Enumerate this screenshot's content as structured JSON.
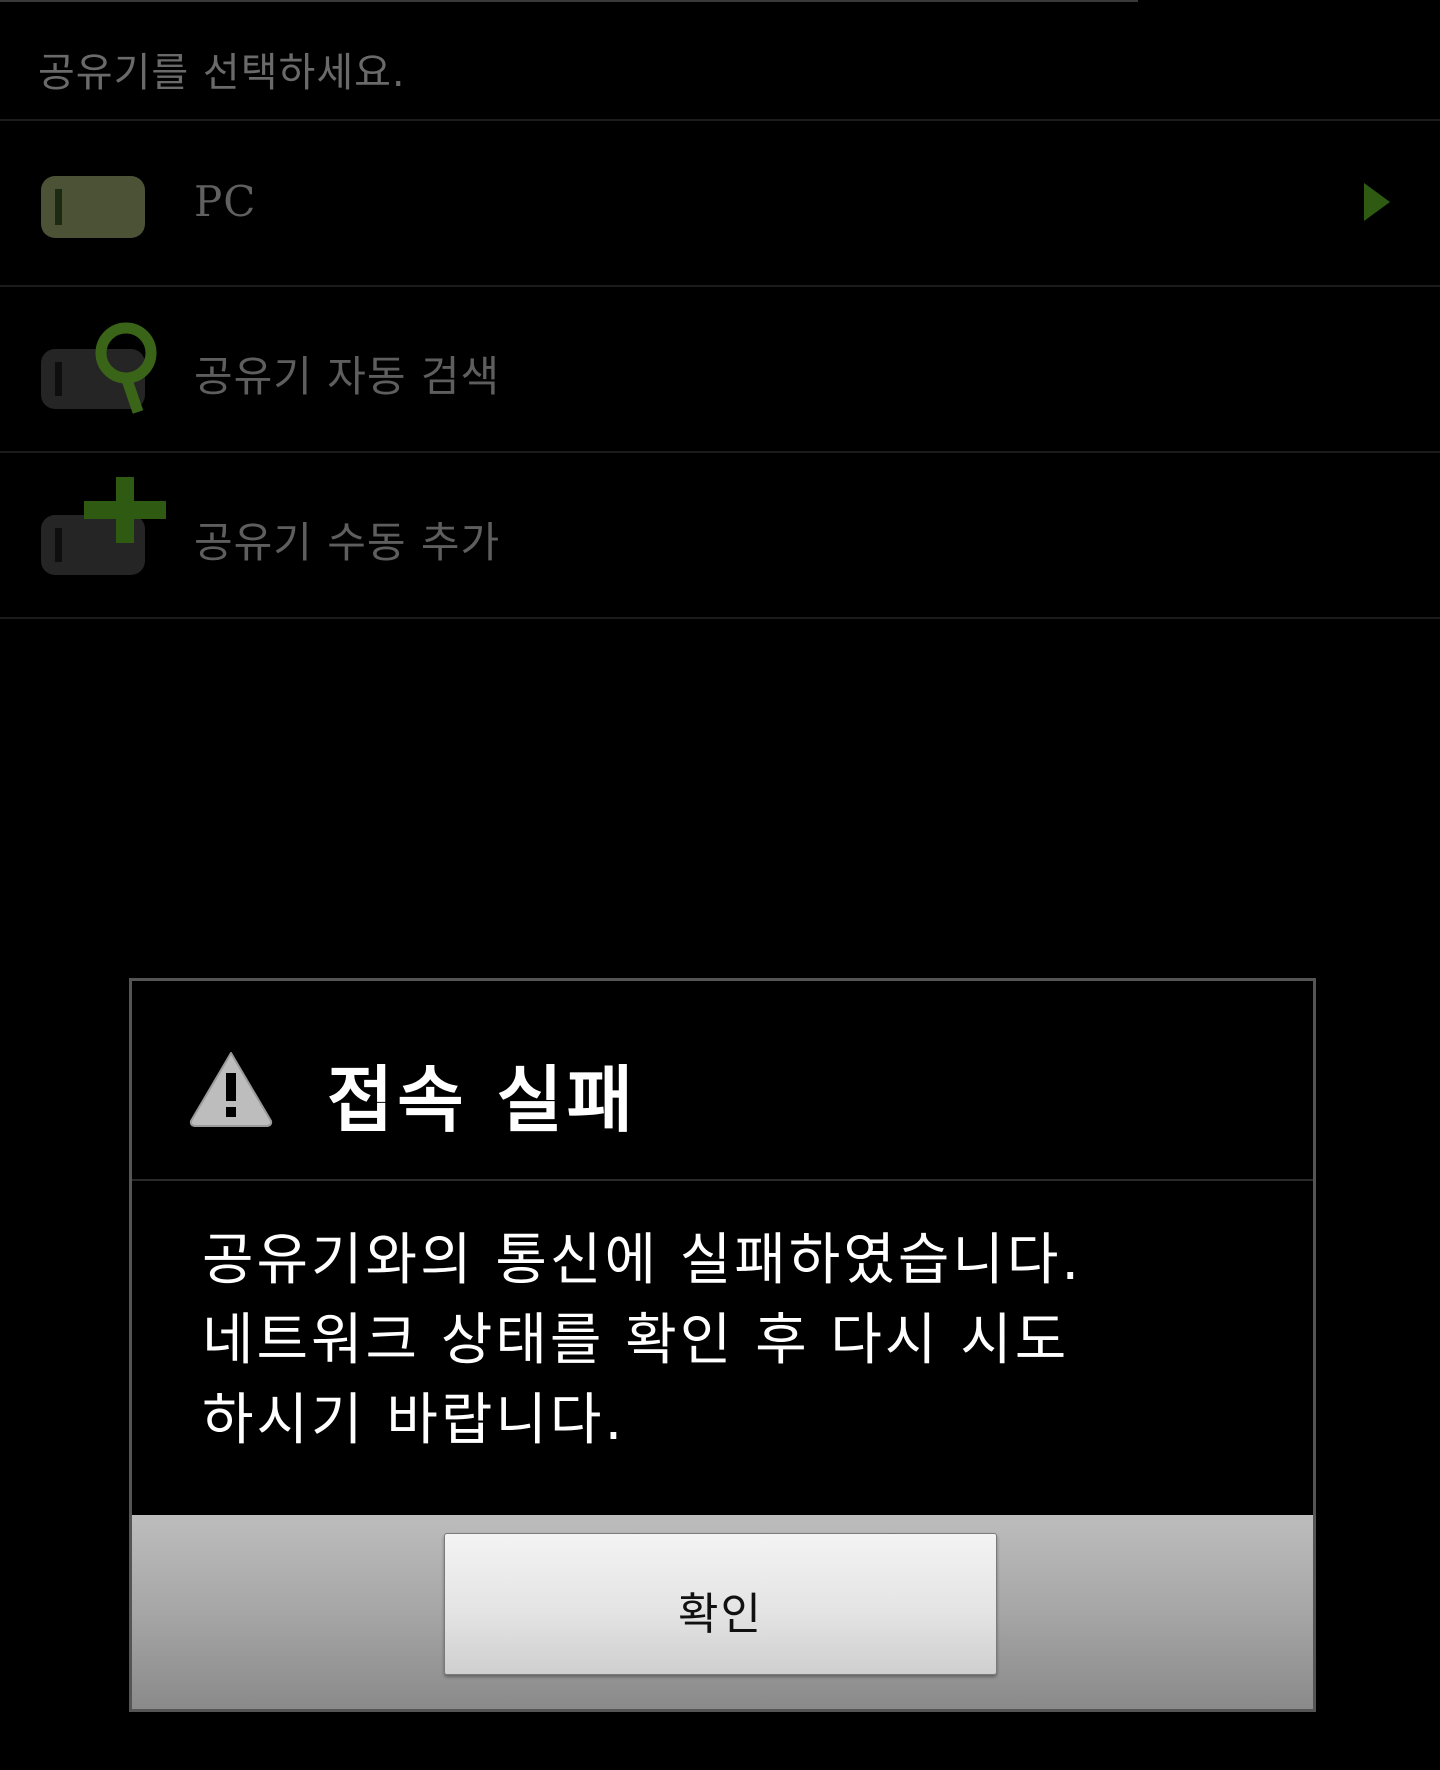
{
  "screen": {
    "header": "공유기를 선택하세요.",
    "items": [
      {
        "label": "PC",
        "icon": "router-icon",
        "has_chevron": true
      },
      {
        "label": "공유기 자동 검색",
        "icon": "router-search-icon"
      },
      {
        "label": "공유기 수동 추가",
        "icon": "router-add-icon"
      }
    ]
  },
  "dialog": {
    "title": "접속 실패",
    "icon": "warning-icon",
    "message": "공유기와의 통신에 실패하였습니다.\n네트워크 상태를 확인 후 다시 시도\n하시기 바랍니다.",
    "ok_button": "확인"
  },
  "colors": {
    "background": "#000000",
    "accent_green": "#3f6b1a",
    "dimmed_text": "#5e5e5e",
    "dialog_border": "#555555"
  }
}
